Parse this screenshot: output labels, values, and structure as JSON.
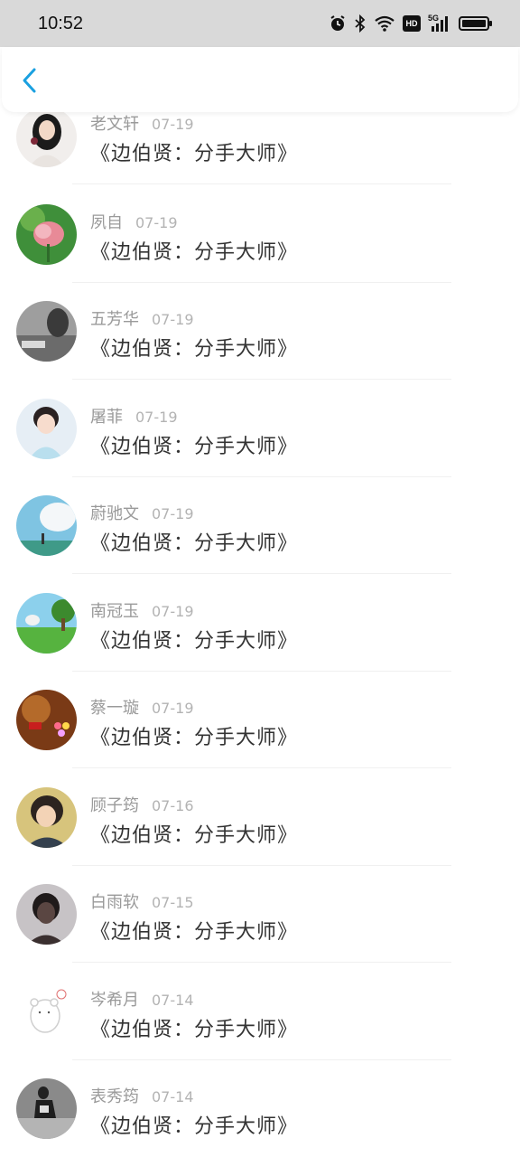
{
  "status_bar": {
    "time": "10:52",
    "network": "5G",
    "hd": "HD"
  },
  "colors": {
    "accent": "#1aa0e0",
    "name_gray": "#9a9a9a",
    "text_dark": "#333333"
  },
  "messages": [
    {
      "name": "老文轩",
      "date": "07-19",
      "text": "《边伯贤：分手大师》",
      "avatar": "girl-portrait"
    },
    {
      "name": "夙自",
      "date": "07-19",
      "text": "《边伯贤：分手大师》",
      "avatar": "pink-rose"
    },
    {
      "name": "五芳华",
      "date": "07-19",
      "text": "《边伯贤：分手大师》",
      "avatar": "grayscale-photo"
    },
    {
      "name": "屠菲",
      "date": "07-19",
      "text": "《边伯贤：分手大师》",
      "avatar": "cartoon-girl"
    },
    {
      "name": "蔚驰文",
      "date": "07-19",
      "text": "《边伯贤：分手大师》",
      "avatar": "sky-clouds"
    },
    {
      "name": "南冠玉",
      "date": "07-19",
      "text": "《边伯贤：分手大师》",
      "avatar": "cartoon-field"
    },
    {
      "name": "蔡一璇",
      "date": "07-19",
      "text": "《边伯贤：分手大师》",
      "avatar": "warm-lights"
    },
    {
      "name": "顾子筠",
      "date": "07-16",
      "text": "《边伯贤：分手大师》",
      "avatar": "anime-girl"
    },
    {
      "name": "白雨软",
      "date": "07-15",
      "text": "《边伯贤：分手大师》",
      "avatar": "dark-portrait"
    },
    {
      "name": "岑希月",
      "date": "07-14",
      "text": "《边伯贤：分手大师》",
      "avatar": "white-bear"
    },
    {
      "name": "表秀筠",
      "date": "07-14",
      "text": "《边伯贤：分手大师》",
      "avatar": "runner-bw"
    }
  ]
}
